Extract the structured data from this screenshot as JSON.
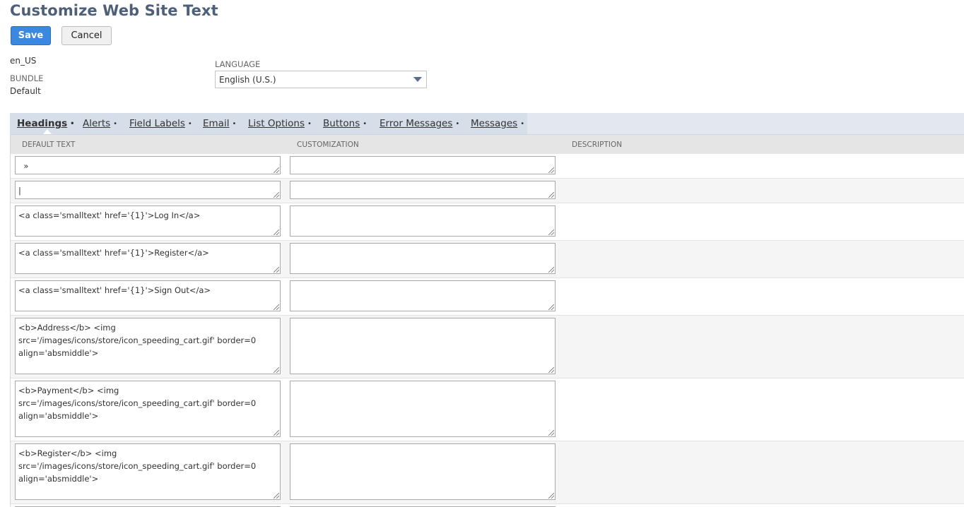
{
  "page": {
    "title": "Customize Web Site Text"
  },
  "buttons": {
    "save": "Save",
    "cancel": "Cancel"
  },
  "info": {
    "locale": "en_US",
    "bundle_label": "BUNDLE",
    "bundle_value": "Default",
    "language_label": "LANGUAGE",
    "language_value": "English (U.S.)"
  },
  "tabs": [
    {
      "label": "Headings",
      "dot": "•",
      "active": true
    },
    {
      "label": "Alerts",
      "dot": "•"
    },
    {
      "label": "Field Labels",
      "dot": "•"
    },
    {
      "label": "Email",
      "dot": "•"
    },
    {
      "label": "List Options",
      "dot": "•"
    },
    {
      "label": "Buttons",
      "dot": "•"
    },
    {
      "label": "Error Messages",
      "dot": "•"
    },
    {
      "label": "Messages",
      "dot": "•"
    }
  ],
  "table": {
    "columns": [
      "DEFAULT TEXT",
      "CUSTOMIZATION",
      "DESCRIPTION"
    ],
    "rows": [
      {
        "default_text": "  »",
        "customization": "",
        "description": ""
      },
      {
        "default_text": "|",
        "customization": "",
        "description": ""
      },
      {
        "default_text": "<a class='smalltext' href='{1}'>Log In</a>",
        "customization": "",
        "description": ""
      },
      {
        "default_text": "<a class='smalltext' href='{1}'>Register</a>",
        "customization": "",
        "description": ""
      },
      {
        "default_text": "<a class='smalltext' href='{1}'>Sign Out</a>",
        "customization": "",
        "description": ""
      },
      {
        "default_text": "<b>Address</b> <img\nsrc='/images/icons/store/icon_speeding_cart.gif' border=0\nalign='absmiddle'>",
        "customization": "",
        "description": ""
      },
      {
        "default_text": "<b>Payment</b> <img\nsrc='/images/icons/store/icon_speeding_cart.gif' border=0\nalign='absmiddle'>",
        "customization": "",
        "description": ""
      },
      {
        "default_text": "<b>Register</b> <img\nsrc='/images/icons/store/icon_speeding_cart.gif' border=0\nalign='absmiddle'>",
        "customization": "",
        "description": ""
      }
    ]
  }
}
